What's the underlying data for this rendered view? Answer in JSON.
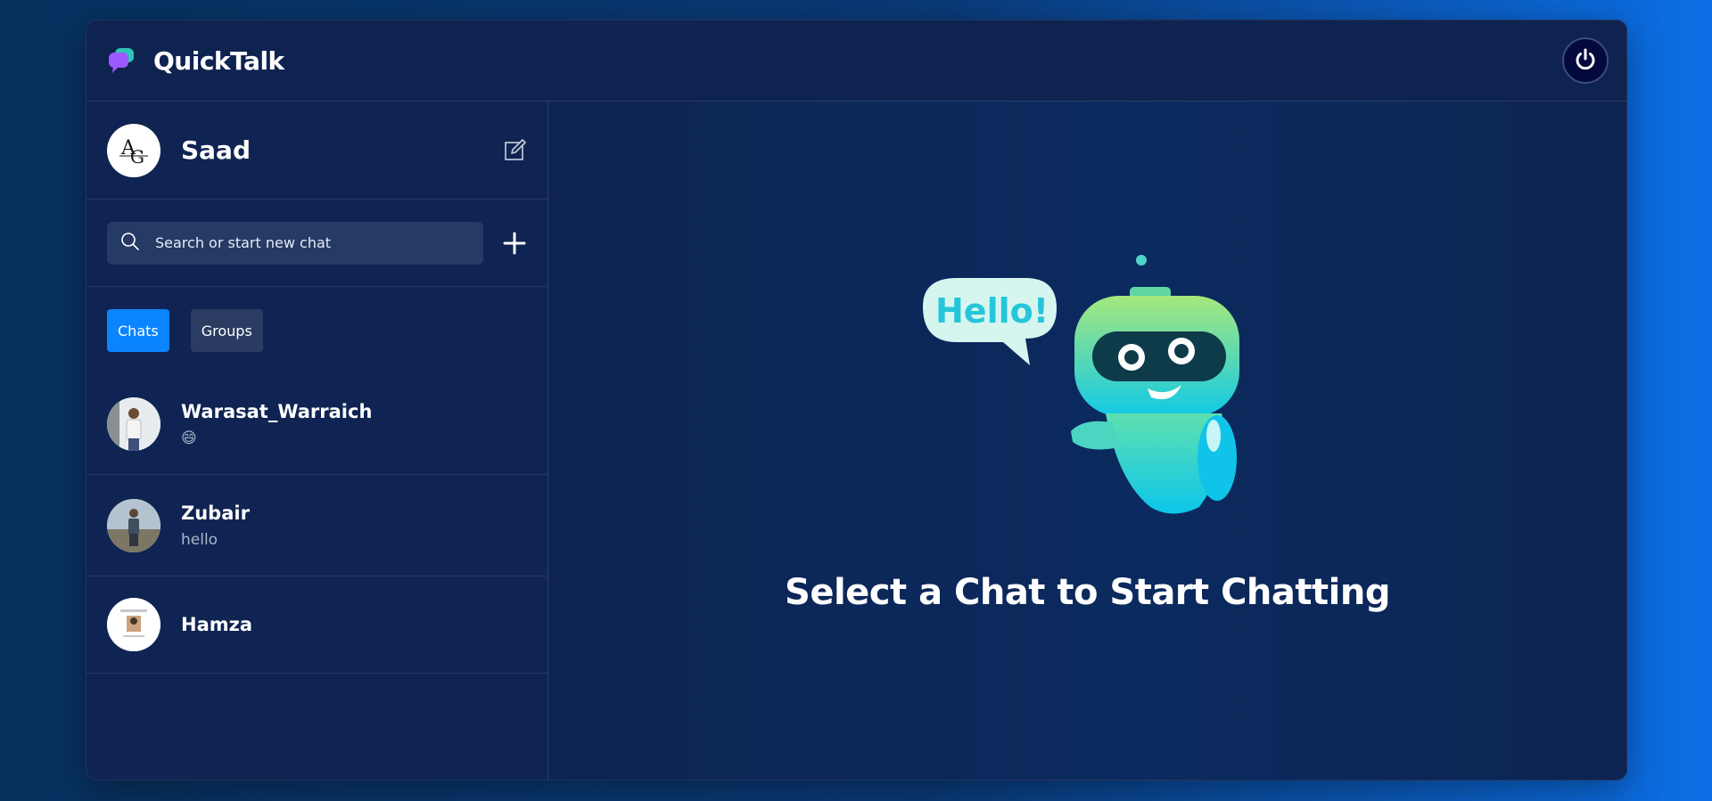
{
  "app": {
    "name": "QuickTalk",
    "logo_icon": "chat-bubbles-icon",
    "power_icon": "power-icon"
  },
  "colors": {
    "accent": "#0a84ff",
    "panel": "#0f2452",
    "input_bg": "#253a64",
    "tab_inactive": "#2a3c62"
  },
  "profile": {
    "name": "Saad",
    "avatar_text": "AG",
    "edit_icon": "edit-icon"
  },
  "search": {
    "placeholder": "Search or start new chat",
    "icon": "search-icon",
    "add_icon": "plus-icon"
  },
  "tabs": [
    {
      "label": "Chats",
      "active": true
    },
    {
      "label": "Groups",
      "active": false
    }
  ],
  "chats": [
    {
      "name": "Warasat_Warraich",
      "preview": "😄"
    },
    {
      "name": "Zubair",
      "preview": "hello"
    },
    {
      "name": "Hamza",
      "preview": ""
    }
  ],
  "welcome": {
    "bubble_text": "Hello!",
    "message": "Select a Chat to Start Chatting"
  }
}
